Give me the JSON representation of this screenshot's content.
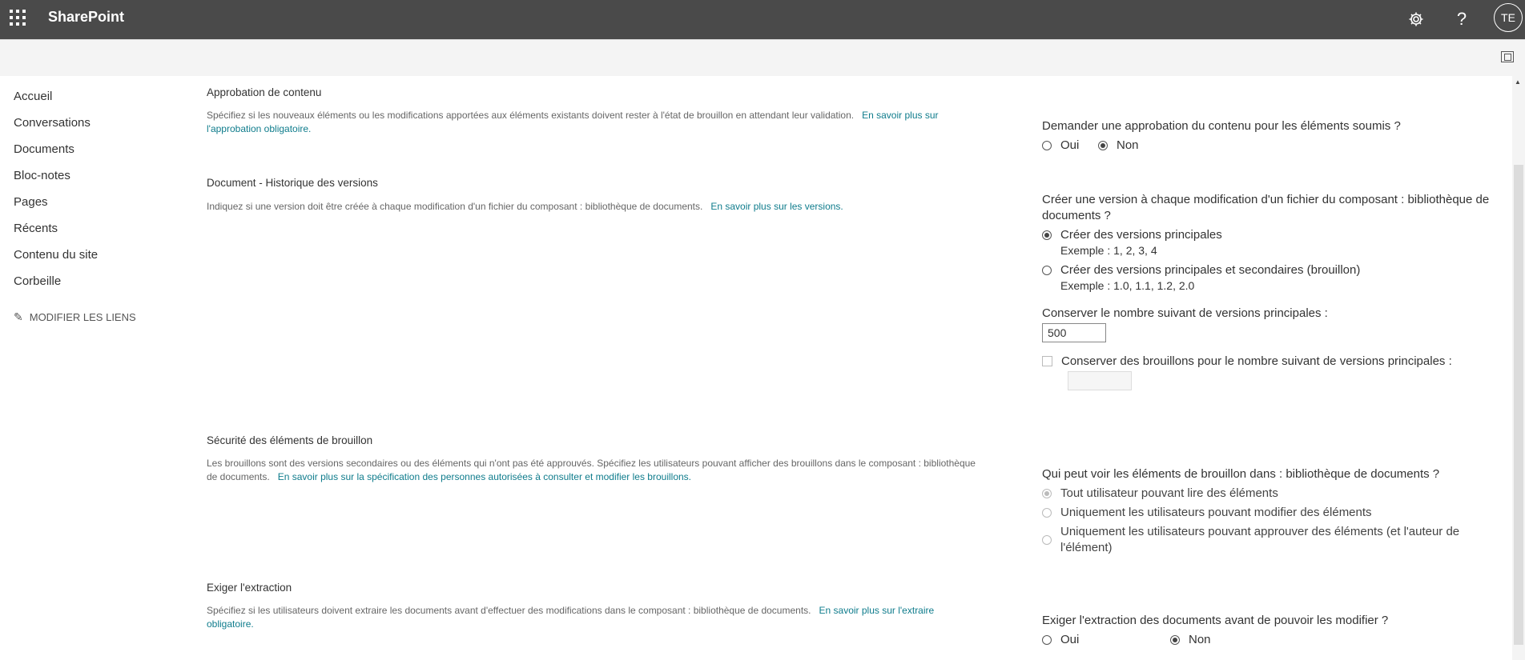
{
  "header": {
    "brand": "SharePoint",
    "settings_icon": "gear-icon",
    "help_label": "?",
    "avatar_initials": "TE"
  },
  "nav": {
    "items": [
      "Accueil",
      "Conversations",
      "Documents",
      "Bloc-notes",
      "Pages",
      "Récents",
      "Contenu du site",
      "Corbeille"
    ],
    "edit_links": "MODIFIER LES LIENS"
  },
  "sections": {
    "approval": {
      "title": "Approbation de contenu",
      "desc": "Spécifiez si les nouveaux éléments ou les modifications apportées aux éléments existants doivent rester à l'état de brouillon en attendant leur validation.",
      "link": "En savoir plus sur l'approbation obligatoire.",
      "question": "Demander une approbation du contenu pour les éléments soumis ?",
      "yes": "Oui",
      "no": "Non"
    },
    "versions": {
      "title": "Document - Historique des versions",
      "desc": "Indiquez si une version doit être créée à chaque modification d'un fichier du composant : bibliothèque de documents.",
      "link": "En savoir plus sur les versions.",
      "question": "Créer une version à chaque modification d'un fichier du composant : bibliothèque de documents ?",
      "opt_major": "Créer des versions principales",
      "opt_major_example": "Exemple : 1, 2, 3, 4",
      "opt_minor": "Créer des versions principales et secondaires (brouillon)",
      "opt_minor_example": "Exemple : 1.0, 1.1, 1.2, 2.0",
      "keep_major_label": "Conserver le nombre suivant de versions principales :",
      "keep_major_value": "500",
      "keep_drafts_label": "Conserver des brouillons pour le nombre suivant de versions principales :"
    },
    "draft_security": {
      "title": "Sécurité des éléments de brouillon",
      "desc": "Les brouillons sont des versions secondaires ou des éléments qui n'ont pas été approuvés. Spécifiez les utilisateurs pouvant afficher des brouillons dans le composant : bibliothèque de documents.",
      "link": "En savoir plus sur la spécification des personnes autorisées à consulter et modifier les brouillons.",
      "question": "Qui peut voir les éléments de brouillon dans : bibliothèque de documents ?",
      "opt_read": "Tout utilisateur pouvant lire des éléments",
      "opt_edit": "Uniquement les utilisateurs pouvant modifier des éléments",
      "opt_approve": "Uniquement les utilisateurs pouvant approuver des éléments (et l'auteur de l'élément)"
    },
    "checkout": {
      "title": "Exiger l'extraction",
      "desc": "Spécifiez si les utilisateurs doivent extraire les documents avant d'effectuer des modifications dans le composant : bibliothèque de documents.",
      "link": "En savoir plus sur l'extraire obligatoire.",
      "question": "Exiger l'extraction des documents avant de pouvoir les modifier ?",
      "yes": "Oui",
      "no": "Non"
    }
  }
}
